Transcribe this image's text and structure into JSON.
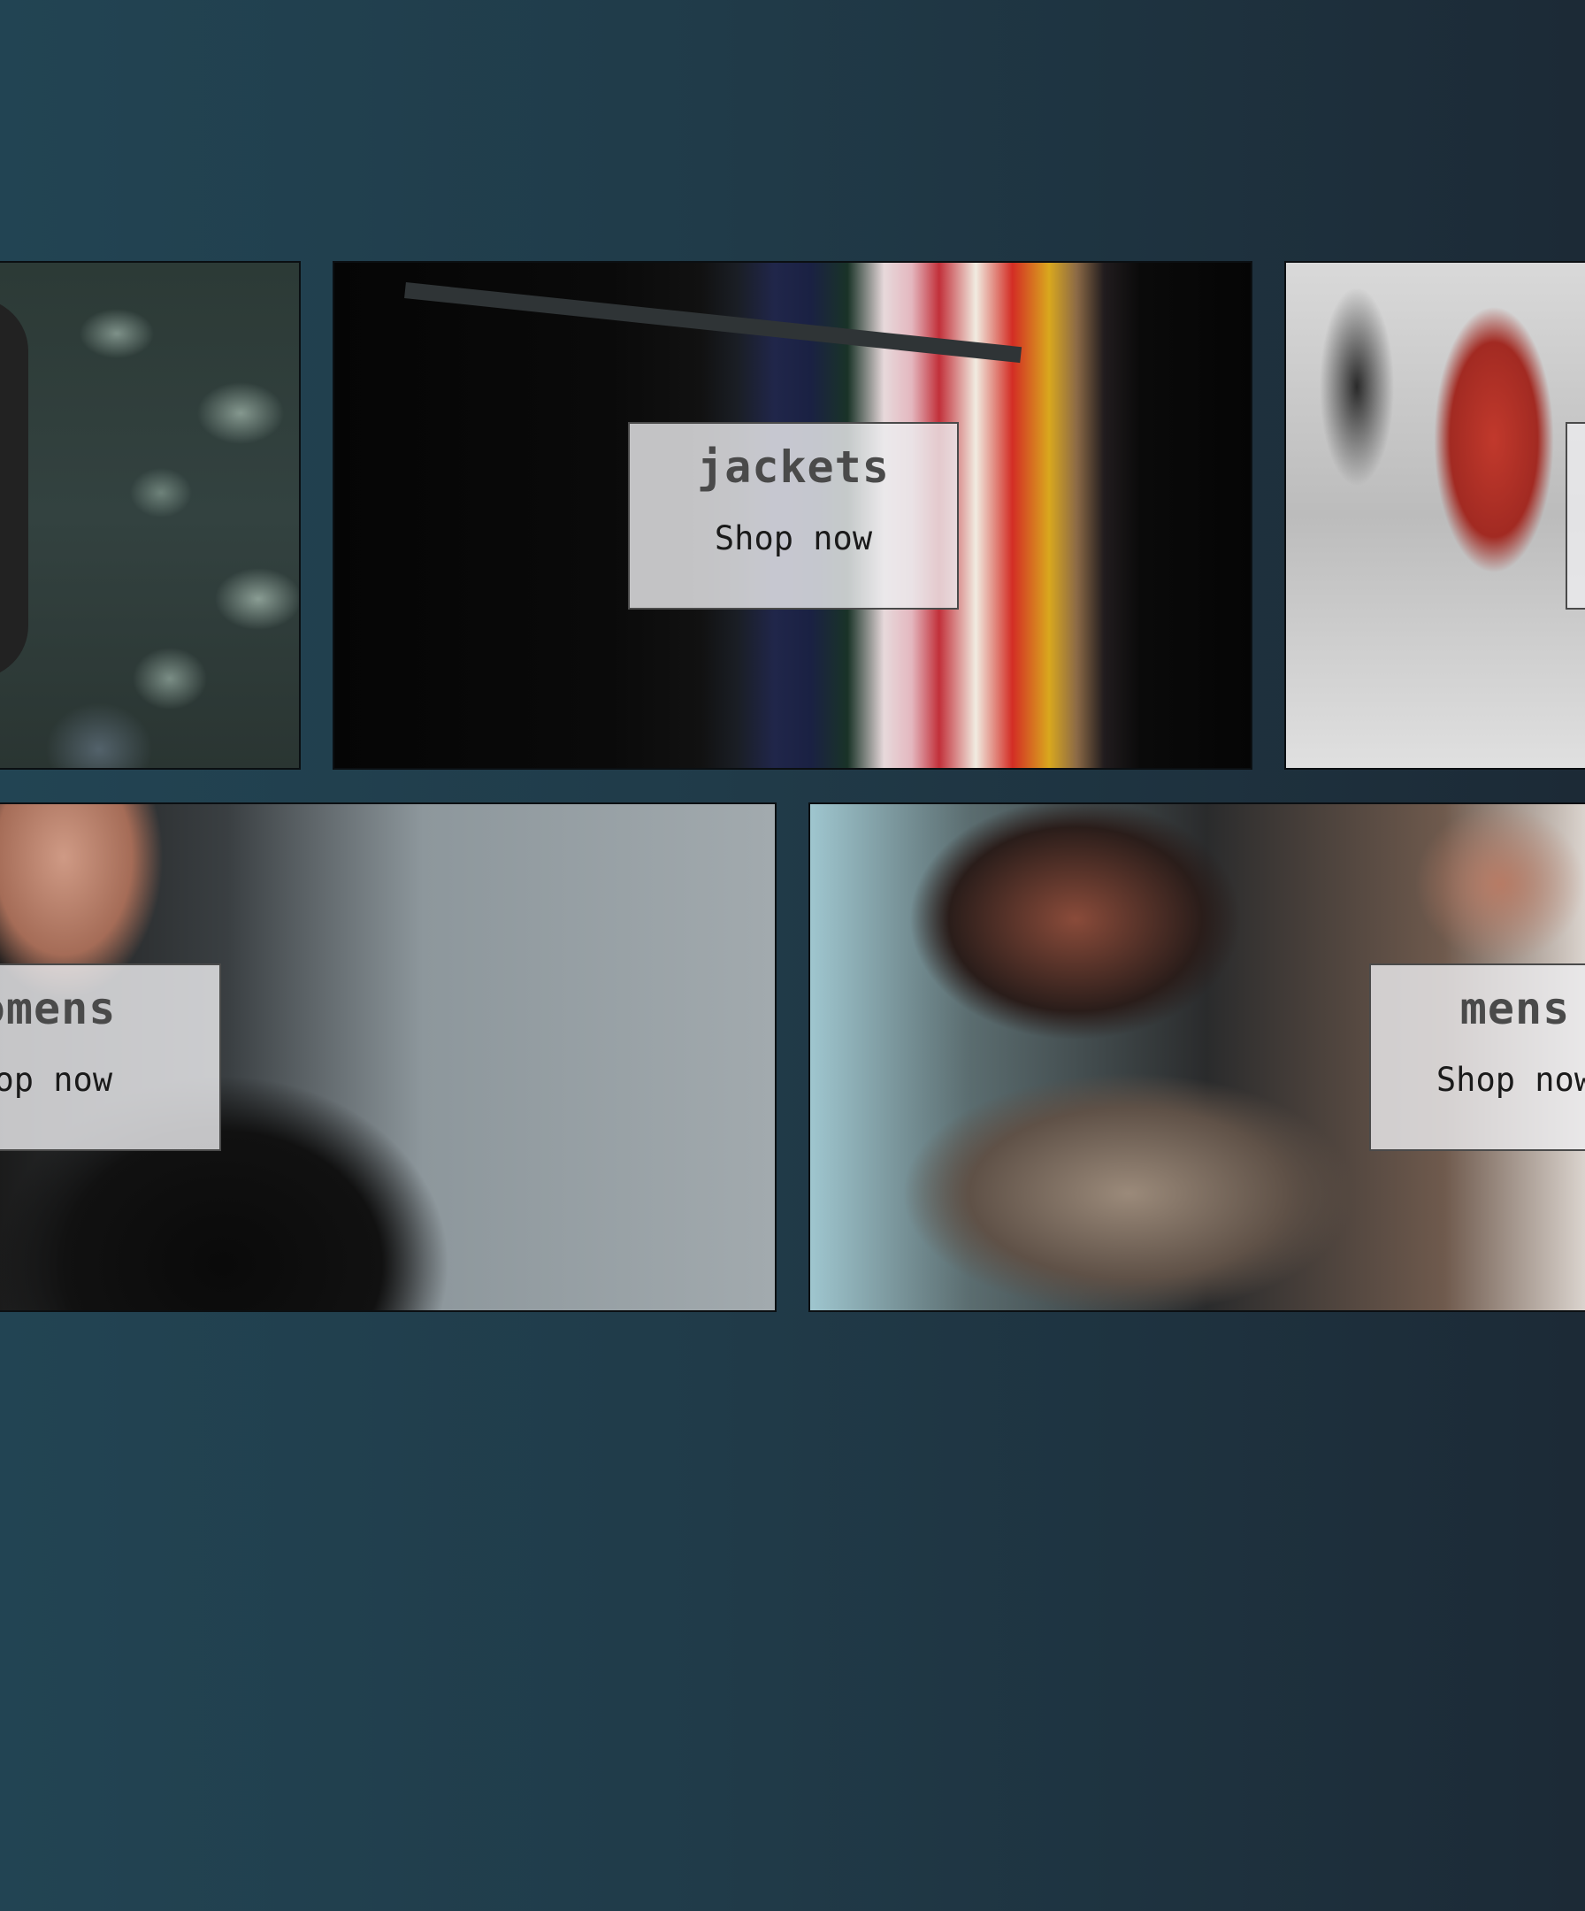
{
  "categories": {
    "caps": {
      "name": "",
      "cta": ""
    },
    "jackets": {
      "name": "jackets",
      "cta": "Shop now"
    },
    "sneakers": {
      "name": "",
      "cta": ""
    },
    "womens": {
      "name": "womens",
      "cta": "Shop now"
    },
    "mens": {
      "name": "mens",
      "cta": "Shop now"
    }
  },
  "colors": {
    "background_left": "#224453",
    "background_right": "#1c2a36",
    "label_background": "#ececee",
    "label_title": "#4a4a4a",
    "label_cta": "#1a1a1a"
  }
}
